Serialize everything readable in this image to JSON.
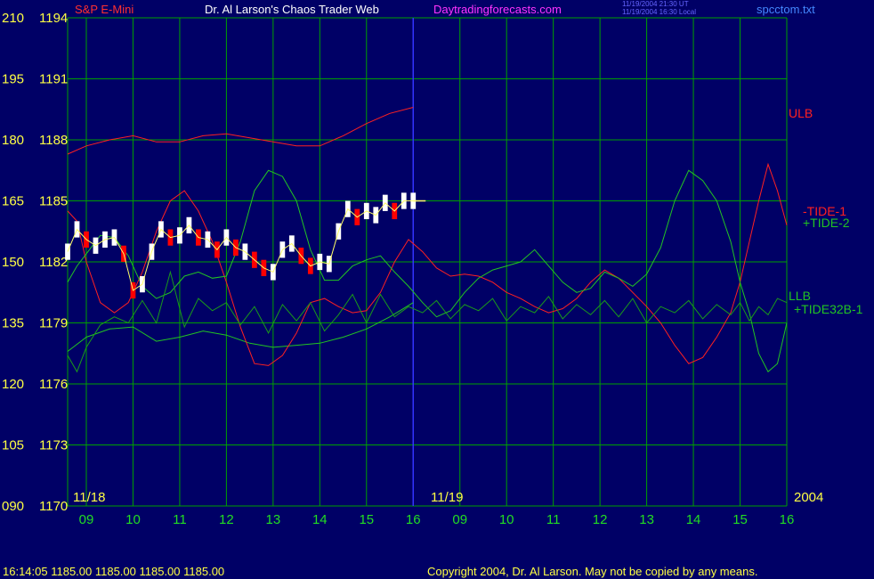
{
  "header": {
    "instrument": "S&P E-Mini",
    "title": "Dr. Al Larson's Chaos Trader Web",
    "website": "Daytradingforecasts.com",
    "timestamp_ut": "11/19/2004 21:30 UT",
    "timestamp_local": "11/19/2004 16:30 Local",
    "filename": "spcctom.txt"
  },
  "footer": {
    "quote": "16:14:05  1185.00 1185.00 1185.00 1185.00",
    "copyright": "Copyright 2004, Dr. Al Larson. May not be copied by any means."
  },
  "colors": {
    "background": "#000066",
    "grid": "#00a000",
    "price_bar": "#ffffff",
    "price_bar_down": "#ff0000",
    "ma_line": "#ffff66",
    "tide1": "#ff2020",
    "tide2": "#22c422",
    "tide32": "#1a9a1a",
    "session_marker": "#3333ff"
  },
  "chart_data": {
    "type": "line",
    "y_left_labels": [
      "210",
      "195",
      "180",
      "165",
      "150",
      "135",
      "120",
      "105",
      "090"
    ],
    "y_right_labels": [
      "1194",
      "1191",
      "1188",
      "1185",
      "1182",
      "1179",
      "1176",
      "1173",
      "1170"
    ],
    "ylim_price": [
      1170,
      1194
    ],
    "ylim_index": [
      90,
      210
    ],
    "x_hours": [
      "09",
      "10",
      "11",
      "12",
      "13",
      "14",
      "15",
      "16",
      "09",
      "10",
      "11",
      "12",
      "13",
      "14",
      "15",
      "16"
    ],
    "x_dates": [
      "11/18",
      "11/19"
    ],
    "year": "2004",
    "series": [
      {
        "name": "ULB",
        "color": "#ff2020",
        "x": [
          8.6,
          9.0,
          9.5,
          10.0,
          10.5,
          11.0,
          11.5,
          12.0,
          12.5,
          13.0,
          13.5,
          14.0,
          14.5,
          15.0,
          15.5,
          16.0
        ],
        "y": [
          1187.3,
          1187.7,
          1188.0,
          1188.2,
          1187.9,
          1187.9,
          1188.2,
          1188.3,
          1188.1,
          1187.9,
          1187.7,
          1187.7,
          1188.2,
          1188.8,
          1189.3,
          1189.6
        ]
      },
      {
        "name": "LLB",
        "color": "#22c422",
        "x": [
          8.6,
          9.0,
          9.5,
          10.0,
          10.5,
          11.0,
          11.5,
          12.0,
          12.5,
          13.0,
          13.5,
          14.0,
          14.5,
          15.0,
          15.5,
          16.0
        ],
        "y": [
          1177.6,
          1178.3,
          1178.7,
          1178.8,
          1178.1,
          1178.3,
          1178.6,
          1178.4,
          1178.0,
          1177.8,
          1177.9,
          1178.0,
          1178.3,
          1178.7,
          1179.3,
          1180.0
        ]
      },
      {
        "name": "-TIDE-1",
        "color": "#ff2020",
        "x": [
          8.6,
          8.8,
          9.0,
          9.3,
          9.6,
          9.9,
          10.2,
          10.5,
          10.8,
          11.1,
          11.4,
          11.7,
          12.0,
          12.3,
          12.6,
          12.9,
          13.2,
          13.5,
          13.8,
          14.1,
          14.4,
          14.7,
          15.0,
          15.3,
          15.6,
          15.9,
          16.2,
          16.5,
          16.8,
          17.1,
          17.4,
          17.7,
          18.0,
          18.3,
          18.6,
          18.9,
          19.2,
          19.5,
          19.8,
          20.1,
          20.4,
          20.7,
          21.0,
          21.3,
          21.6,
          21.9,
          22.2,
          22.5,
          22.8,
          23.0,
          23.2,
          23.4,
          23.6,
          23.8,
          24.0
        ],
        "y": [
          1184.5,
          1184.0,
          1182.0,
          1180.0,
          1179.5,
          1180.0,
          1181.5,
          1183.5,
          1185.0,
          1185.5,
          1184.5,
          1183.0,
          1181.0,
          1178.8,
          1177.0,
          1176.9,
          1177.4,
          1178.5,
          1180.0,
          1180.2,
          1179.8,
          1179.5,
          1179.6,
          1180.5,
          1182.0,
          1183.1,
          1182.5,
          1181.7,
          1181.3,
          1181.4,
          1181.3,
          1181.0,
          1180.5,
          1180.2,
          1179.8,
          1179.5,
          1179.7,
          1180.2,
          1181.0,
          1181.6,
          1181.2,
          1180.5,
          1179.8,
          1179.0,
          1177.9,
          1177.0,
          1177.3,
          1178.3,
          1179.5,
          1181.0,
          1183.0,
          1185.0,
          1186.8,
          1185.5,
          1183.8
        ]
      },
      {
        "name": "+TIDE-2",
        "color": "#22c422",
        "x": [
          8.6,
          8.8,
          9.0,
          9.3,
          9.6,
          9.9,
          10.2,
          10.5,
          10.8,
          11.1,
          11.4,
          11.7,
          12.0,
          12.3,
          12.6,
          12.9,
          13.2,
          13.5,
          13.8,
          14.1,
          14.4,
          14.7,
          15.0,
          15.3,
          15.6,
          15.9,
          16.2,
          16.5,
          16.8,
          17.1,
          17.4,
          17.7,
          18.0,
          18.3,
          18.6,
          18.9,
          19.2,
          19.5,
          19.8,
          20.1,
          20.4,
          20.7,
          21.0,
          21.3,
          21.6,
          21.9,
          22.2,
          22.5,
          22.8,
          23.0,
          23.2,
          23.4,
          23.6,
          23.8,
          24.0
        ],
        "y": [
          1181.0,
          1181.8,
          1182.4,
          1183.3,
          1183.2,
          1182.3,
          1180.8,
          1180.2,
          1180.5,
          1181.3,
          1181.5,
          1181.2,
          1181.3,
          1183.0,
          1185.5,
          1186.5,
          1186.2,
          1185.0,
          1182.6,
          1181.1,
          1181.1,
          1181.8,
          1182.1,
          1182.3,
          1181.5,
          1180.8,
          1180.0,
          1179.3,
          1179.6,
          1180.5,
          1181.2,
          1181.6,
          1181.8,
          1182.0,
          1182.6,
          1181.8,
          1181.0,
          1180.5,
          1180.7,
          1181.5,
          1181.2,
          1180.8,
          1181.4,
          1182.7,
          1185.0,
          1186.5,
          1186.0,
          1185.0,
          1183.0,
          1181.0,
          1179.5,
          1177.5,
          1176.6,
          1177.0,
          1179.0
        ]
      },
      {
        "name": "+TIDE32B-1",
        "color": "#1a9a1a",
        "x": [
          8.6,
          8.8,
          9.0,
          9.3,
          9.6,
          9.9,
          10.2,
          10.5,
          10.8,
          11.1,
          11.4,
          11.7,
          12.0,
          12.3,
          12.6,
          12.9,
          13.2,
          13.5,
          13.8,
          14.1,
          14.4,
          14.7,
          15.0,
          15.3,
          15.6,
          15.9,
          16.2,
          16.5,
          16.8,
          17.1,
          17.4,
          17.7,
          18.0,
          18.3,
          18.6,
          18.9,
          19.2,
          19.5,
          19.8,
          20.1,
          20.4,
          20.7,
          21.0,
          21.3,
          21.6,
          21.9,
          22.2,
          22.5,
          22.8,
          23.0,
          23.2,
          23.4,
          23.6,
          23.8,
          24.0
        ],
        "y": [
          1177.4,
          1176.6,
          1177.8,
          1178.9,
          1179.3,
          1179.0,
          1180.1,
          1179.0,
          1181.5,
          1178.8,
          1180.2,
          1179.6,
          1180.0,
          1178.9,
          1179.8,
          1178.5,
          1179.9,
          1179.1,
          1180.0,
          1178.6,
          1179.4,
          1180.4,
          1179.0,
          1180.4,
          1179.3,
          1179.8,
          1179.5,
          1180.1,
          1179.2,
          1179.9,
          1179.6,
          1180.2,
          1179.1,
          1179.8,
          1179.5,
          1180.3,
          1179.2,
          1179.9,
          1179.4,
          1180.1,
          1179.3,
          1180.2,
          1179.0,
          1179.8,
          1179.5,
          1180.1,
          1179.2,
          1179.9,
          1179.4,
          1180.0,
          1179.1,
          1179.8,
          1179.4,
          1180.2,
          1180.0
        ]
      },
      {
        "name": "price",
        "color": "#ffffff",
        "x": [
          8.6,
          8.8,
          9.0,
          9.2,
          9.4,
          9.6,
          9.8,
          10.0,
          10.2,
          10.4,
          10.6,
          10.8,
          11.0,
          11.2,
          11.4,
          11.6,
          11.8,
          12.0,
          12.2,
          12.4,
          12.6,
          12.8,
          13.0,
          13.2,
          13.4,
          13.6,
          13.8,
          14.0,
          14.2,
          14.4,
          14.6,
          14.8,
          15.0,
          15.2,
          15.4,
          15.6,
          15.8,
          16.0
        ],
        "y": [
          1182.5,
          1183.6,
          1183.1,
          1182.8,
          1183.1,
          1183.2,
          1182.4,
          1180.6,
          1180.9,
          1182.5,
          1183.6,
          1183.2,
          1183.3,
          1183.8,
          1183.2,
          1183.1,
          1182.6,
          1183.2,
          1182.7,
          1182.5,
          1182.1,
          1181.7,
          1181.5,
          1182.6,
          1182.9,
          1182.3,
          1181.8,
          1182.0,
          1181.9,
          1183.5,
          1184.6,
          1184.2,
          1184.5,
          1184.3,
          1184.9,
          1184.5,
          1185.0,
          1185.0
        ]
      }
    ]
  }
}
